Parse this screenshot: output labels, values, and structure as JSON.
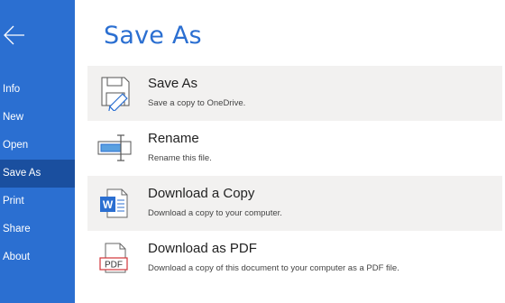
{
  "header": {
    "title": "Save As"
  },
  "sidebar": {
    "back_icon": "arrow-left-icon",
    "items": [
      {
        "label": "Info"
      },
      {
        "label": "New"
      },
      {
        "label": "Open"
      },
      {
        "label": "Save As",
        "active": true
      },
      {
        "label": "Print"
      },
      {
        "label": "Share"
      },
      {
        "label": "About"
      }
    ]
  },
  "options": [
    {
      "title": "Save As",
      "description": "Save a copy to OneDrive.",
      "icon": "save-as-icon"
    },
    {
      "title": "Rename",
      "description": "Rename this file.",
      "icon": "rename-icon"
    },
    {
      "title": "Download a Copy",
      "description": "Download a copy to your computer.",
      "icon": "word-document-icon",
      "icon_text": "W"
    },
    {
      "title": "Download as PDF",
      "description": "Download a copy of this document to your computer as a PDF file.",
      "icon": "pdf-document-icon",
      "icon_text": "PDF"
    }
  ],
  "colors": {
    "sidebar": "#2b6fd1",
    "sidebar_active": "#1a4f9f",
    "accent": "#2b6fd1",
    "pdf_red": "#d13438",
    "option_shade": "#f2f1f0"
  }
}
